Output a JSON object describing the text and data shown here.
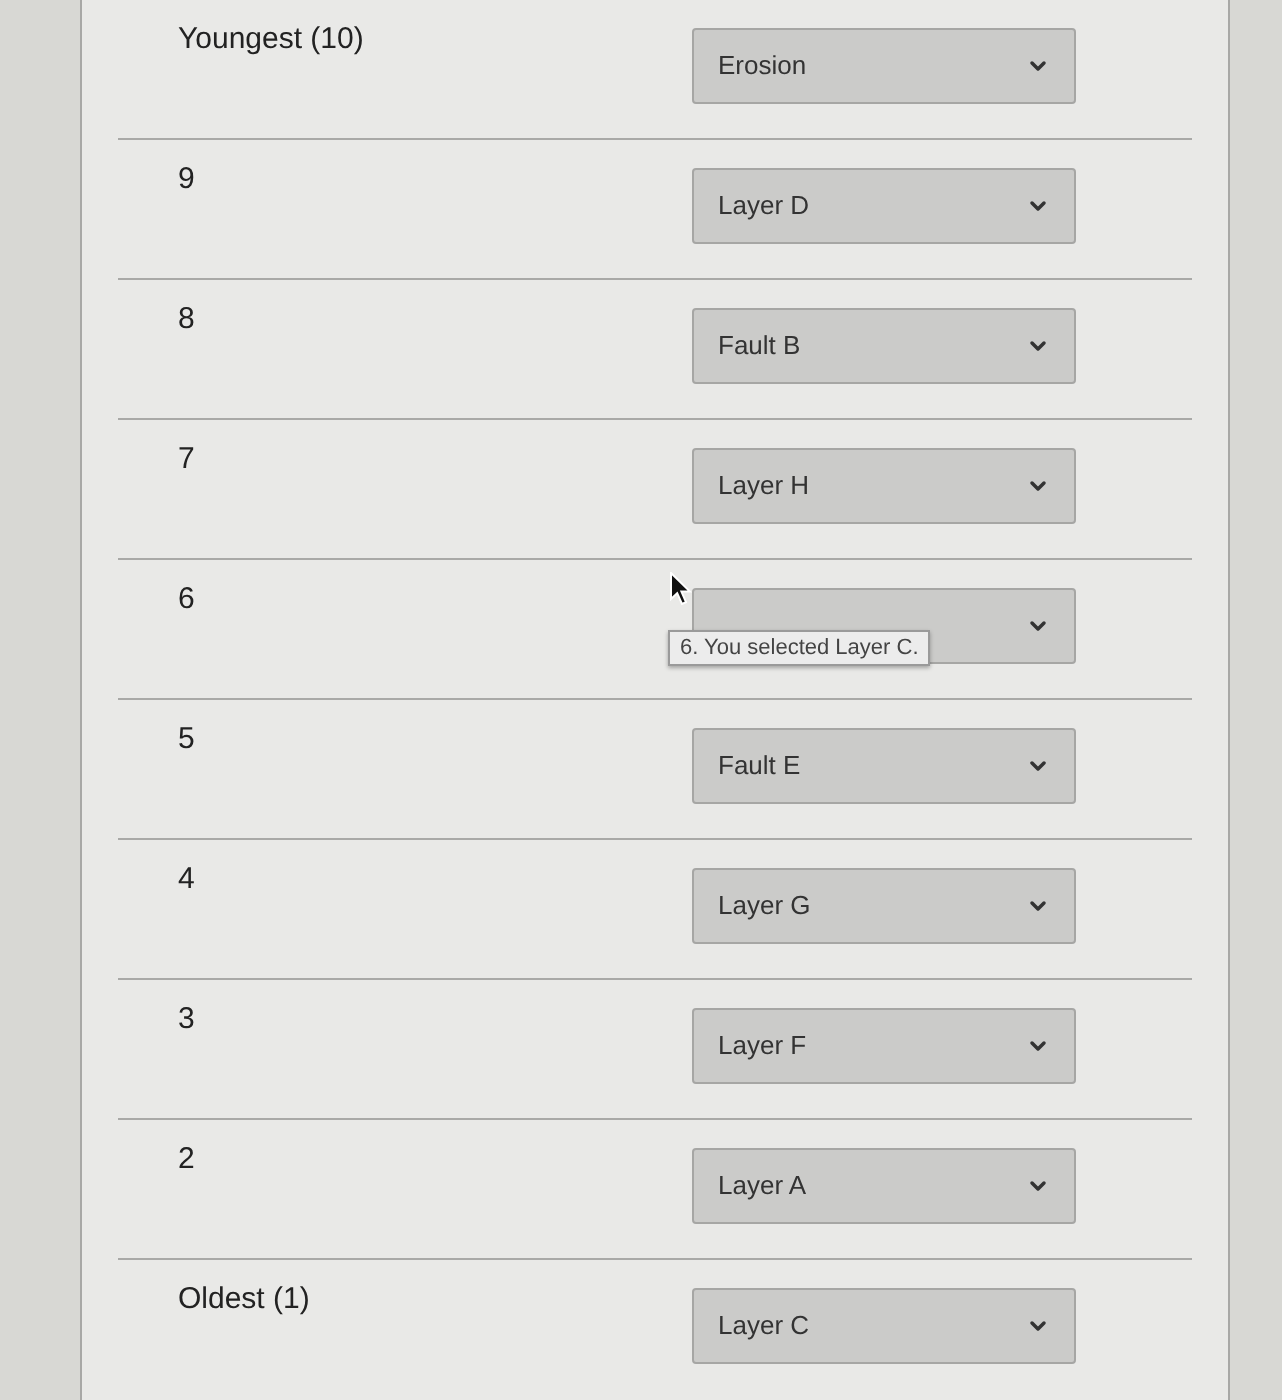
{
  "rows": [
    {
      "label": "Youngest (10)",
      "value": "Erosion"
    },
    {
      "label": "9",
      "value": "Layer D"
    },
    {
      "label": "8",
      "value": "Fault B"
    },
    {
      "label": "7",
      "value": "Layer H"
    },
    {
      "label": "6",
      "tooltip": "6. You selected Layer C."
    },
    {
      "label": "5",
      "value": "Fault E"
    },
    {
      "label": "4",
      "value": "Layer G"
    },
    {
      "label": "3",
      "value": "Layer F"
    },
    {
      "label": "2",
      "value": "Layer A"
    },
    {
      "label": "Oldest (1)",
      "value": "Layer C"
    }
  ]
}
